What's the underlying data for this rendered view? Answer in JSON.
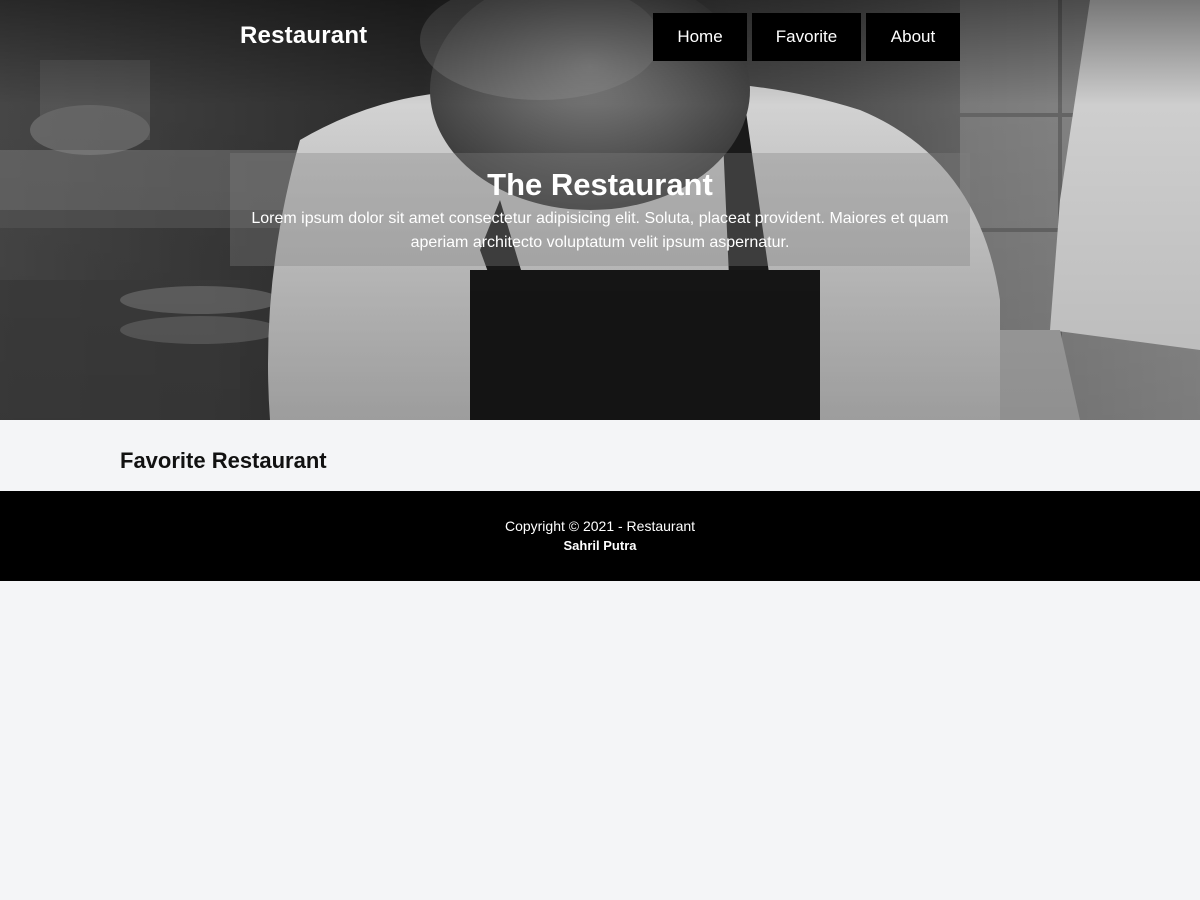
{
  "header": {
    "brand": "Restaurant",
    "nav": [
      {
        "label": "Home"
      },
      {
        "label": "Favorite"
      },
      {
        "label": "About"
      }
    ]
  },
  "hero": {
    "title": "The Restaurant",
    "description": "Lorem ipsum dolor sit amet consectetur adipisicing elit. Soluta, placeat provident. Maiores et quam aperiam architecto voluptatum velit ipsum aspernatur.",
    "image": "chef-working-in-kitchen-photo"
  },
  "main": {
    "section_title": "Favorite Restaurant"
  },
  "footer": {
    "copyright": "Copyright © 2021 - Restaurant",
    "author": "Sahril Putra"
  },
  "colors": {
    "page_background": "#f4f5f7",
    "nav_background": "#000000",
    "footer_background": "#000000",
    "text_light": "#ffffff",
    "text_dark": "#111111"
  }
}
